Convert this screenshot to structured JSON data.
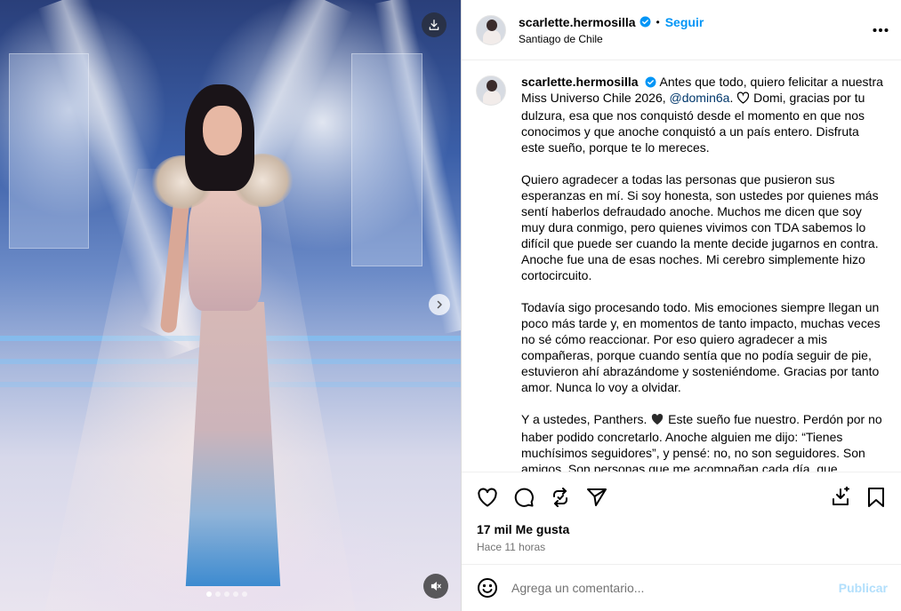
{
  "post": {
    "username": "scarlette.hermosilla",
    "follow_label": "Seguir",
    "separator": "•",
    "location": "Santiago de Chile"
  },
  "media": {
    "carousel_dots": 5,
    "active_dot": 0
  },
  "caption": {
    "username": "scarlette.hermosilla",
    "p1_a": "Antes que todo, quiero felicitar a nuestra Miss Universo Chile 2026,",
    "mention": "@domin6a",
    "p1_b": ". ",
    "p1_c": " Domi, gracias por tu dulzura, esa que nos conquistó desde el momento en que nos conocimos y que anoche conquistó a un país entero. Disfruta este sueño, porque te lo mereces.",
    "p2": "Quiero agradecer a todas las personas que pusieron sus esperanzas en mí. Si soy honesta, son ustedes por quienes más sentí haberlos defraudado anoche. Muchos me dicen que soy muy dura conmigo, pero quienes vivimos con TDA sabemos lo difícil que puede ser cuando la mente decide jugarnos en contra. Anoche fue una de esas noches. Mi cerebro simplemente hizo cortocircuito.",
    "p3": "Todavía sigo procesando todo. Mis emociones siempre llegan un poco más tarde y, en momentos de tanto impacto, muchas veces no sé cómo reaccionar. Por eso quiero agradecer a mis compañeras, porque cuando sentía que no podía seguir de pie, estuvieron ahí abrazándome y sosteniéndome. Gracias por tanto amor. Nunca lo voy a olvidar.",
    "p4_a": "Y a ustedes, Panthers. ",
    "p4_b": " Este sueño fue nuestro. Perdón por no haber podido concretarlo. Anoche alguien me dijo: “Tienes muchísimos seguidores”, y pensé: no, no son seguidores. Son amigos. Son personas que me acompañan cada día, que"
  },
  "stats": {
    "likes": "17 mil Me gusta",
    "time": "Hace 11 horas"
  },
  "comment": {
    "placeholder": "Agrega un comentario...",
    "publish_label": "Publicar"
  },
  "colors": {
    "link_blue": "#0095f6",
    "mention_blue": "#00376b",
    "publish_disabled": "#b2dffc",
    "secondary_text": "#737373"
  },
  "icons": [
    "download-icon",
    "chevron-right-icon",
    "mute-icon",
    "verified-icon",
    "more-icon",
    "heart-icon",
    "comment-icon",
    "repost-icon",
    "share-icon",
    "save-icon",
    "bookmark-icon",
    "emoji-icon",
    "black-heart-icon",
    "outline-heart-icon"
  ]
}
